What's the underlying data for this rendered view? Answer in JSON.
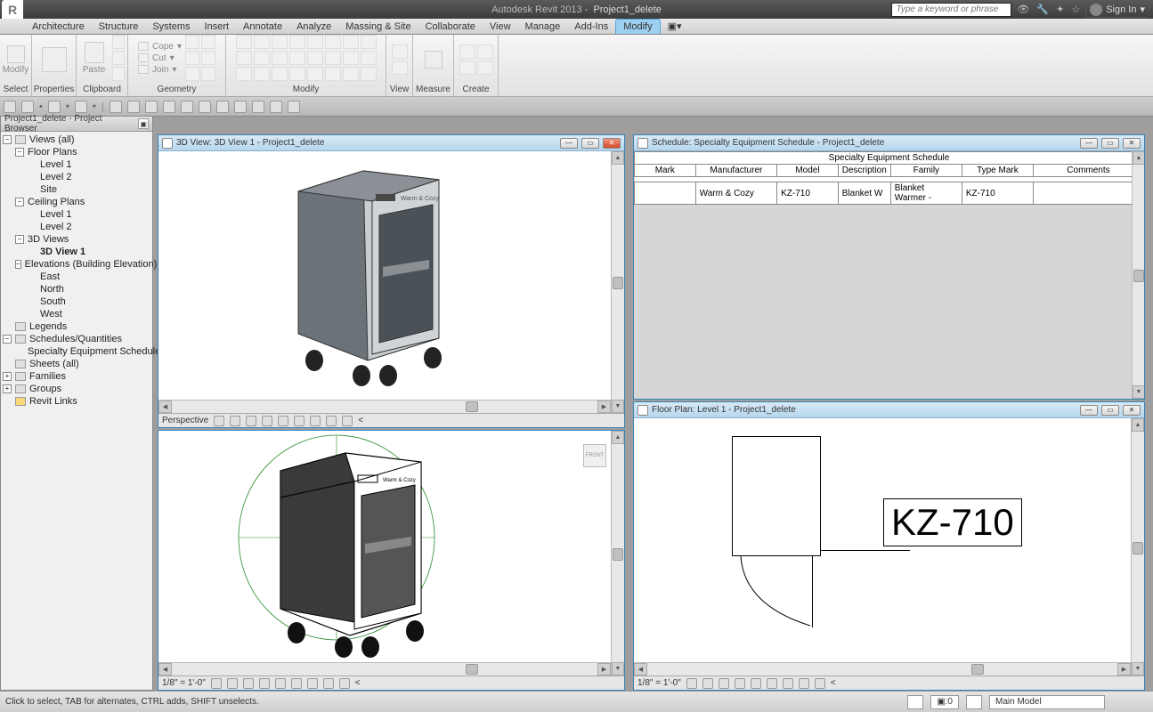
{
  "app": {
    "title": "Autodesk Revit 2013 -",
    "project": "Project1_delete",
    "search_placeholder": "Type a keyword or phrase",
    "signin": "Sign In"
  },
  "menu": {
    "items": [
      "Architecture",
      "Structure",
      "Systems",
      "Insert",
      "Annotate",
      "Analyze",
      "Massing & Site",
      "Collaborate",
      "View",
      "Manage",
      "Add-Ins",
      "Modify"
    ],
    "active": "Modify"
  },
  "ribbon": {
    "groups": [
      {
        "label": "Select",
        "big": "Modify"
      },
      {
        "label": "Properties",
        "big": ""
      },
      {
        "label": "Clipboard",
        "t": [
          "Cope",
          "Cut",
          "Join"
        ],
        "paste": "Paste"
      },
      {
        "label": "Geometry",
        "t": [
          "Cope",
          "Cut",
          "Join"
        ]
      },
      {
        "label": "Modify"
      },
      {
        "label": "View"
      },
      {
        "label": "Measure"
      },
      {
        "label": "Create"
      }
    ]
  },
  "browser": {
    "title": "Project1_delete - Project Browser",
    "views_root": "Views (all)",
    "floor_plans": "Floor Plans",
    "fp_items": [
      "Level 1",
      "Level 2",
      "Site"
    ],
    "ceiling_plans": "Ceiling Plans",
    "cp_items": [
      "Level 1",
      "Level 2"
    ],
    "3d_views": "3D Views",
    "v3d_items": [
      "3D View 1"
    ],
    "elevations": "Elevations (Building Elevation)",
    "elev_items": [
      "East",
      "North",
      "South",
      "West"
    ],
    "legends": "Legends",
    "schedules": "Schedules/Quantities",
    "sch_items": [
      "Specialty Equipment Schedule"
    ],
    "sheets": "Sheets (all)",
    "families": "Families",
    "groups": "Groups",
    "revit_links": "Revit Links"
  },
  "panels": {
    "view3d": {
      "title": "3D View: 3D View 1 - Project1_delete",
      "footer": "Perspective",
      "brand": "Warm & Cozy"
    },
    "hidden3d": {
      "scale": "1/8\" = 1'-0\"",
      "brand": "Warm & Cozy"
    },
    "schedule": {
      "title": "Schedule: Specialty Equipment Schedule - Project1_delete",
      "table_title": "Specialty Equipment Schedule",
      "headers": [
        "Mark",
        "Manufacturer",
        "Model",
        "Description",
        "Family",
        "Type Mark",
        "Comments"
      ],
      "row": [
        "",
        "Warm & Cozy",
        "KZ-710",
        "Blanket W",
        "Blanket Warmer -",
        "KZ-710",
        ""
      ]
    },
    "floorplan": {
      "title": "Floor Plan: Level 1 - Project1_delete",
      "scale": "1/8\" = 1'-0\"",
      "label": "KZ-710"
    }
  },
  "status": {
    "hint": "Click to select, TAB for alternates, CTRL adds, SHIFT unselects.",
    "count": ":0",
    "model": "Main Model"
  }
}
